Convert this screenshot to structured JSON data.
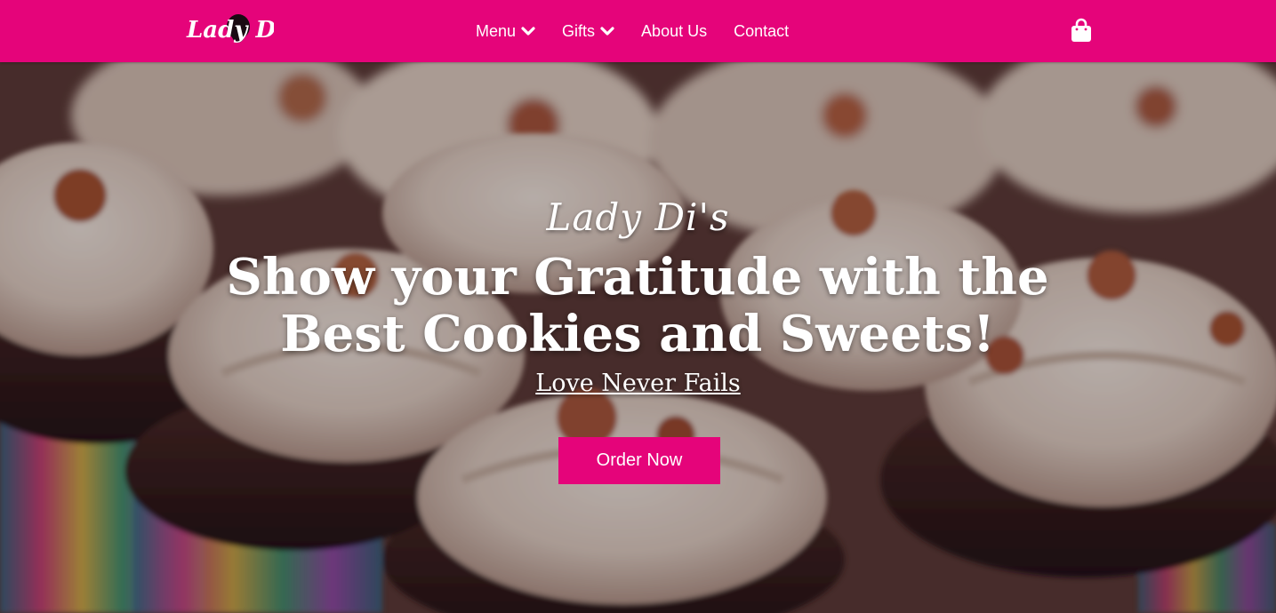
{
  "brand": {
    "logo_text": "Lady Di's",
    "accent_color": "#e5047a"
  },
  "nav": {
    "items": [
      {
        "label": "Menu",
        "has_dropdown": true
      },
      {
        "label": "Gifts",
        "has_dropdown": true
      },
      {
        "label": "About Us",
        "has_dropdown": false
      },
      {
        "label": "Contact",
        "has_dropdown": false
      }
    ],
    "cart_icon": "shopping-bag-icon",
    "dropdown_icon": "chevron-down-icon"
  },
  "hero": {
    "script_title": "Lady Di's",
    "headline": "Show your Gratitude with the Best Cookies and Sweets!",
    "tagline": "Love Never Fails",
    "cta_label": "Order Now"
  }
}
